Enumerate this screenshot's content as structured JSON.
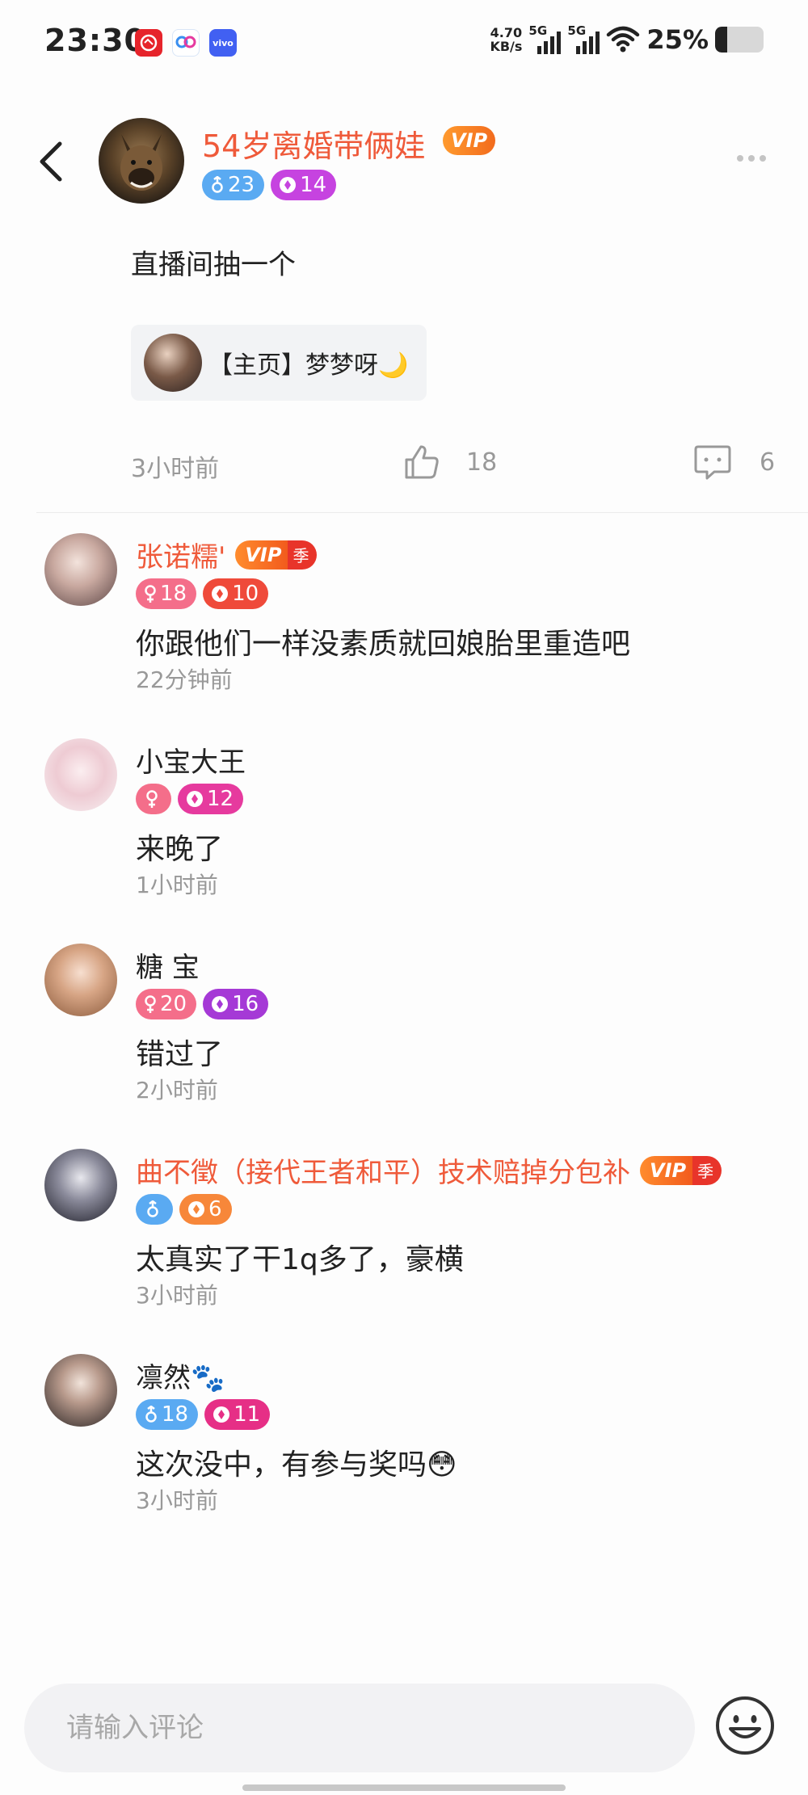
{
  "status_bar": {
    "time": "23:30",
    "net_speed_value": "4.70",
    "net_speed_unit": "KB/s",
    "sim1": "5G",
    "sim2": "5G",
    "battery": "25%",
    "battery_level": 0.25,
    "app_icons": [
      "pinduoduo-icon",
      "baidu-netdisk-icon",
      "vivo-icon"
    ],
    "app_label_3": "vivo"
  },
  "post": {
    "author": "54岁离婚带俩娃",
    "vip_label": "VIP",
    "badges": [
      {
        "type": "male",
        "value": "23"
      },
      {
        "type": "level",
        "value": "14"
      }
    ],
    "text": "直播间抽一个",
    "card_text": "【主页】梦梦呀🌙",
    "time": "3小时前",
    "likes": "18",
    "comments": "6"
  },
  "comments": [
    {
      "name": "张诺糯'",
      "vip": "VIP",
      "season": "季",
      "gender_value": "18",
      "level": "10",
      "text": "你跟他们一样没素质就回娘胎里重造吧",
      "time": "22分钟前"
    },
    {
      "name": "小宝大王",
      "gender_value": "",
      "level": "12",
      "text": "来晚了",
      "time": "1小时前"
    },
    {
      "name": "糖 宝",
      "gender_value": "20",
      "level": "16",
      "text": "错过了",
      "time": "2小时前"
    },
    {
      "name": "曲不徵（接代王者和平）技术赔掉分包补",
      "vip": "VIP",
      "season": "季",
      "gender_value": "",
      "level": "6",
      "text": "太真实了干1q多了，豪横",
      "time": "3小时前"
    },
    {
      "name": "凛然🐾",
      "gender_value": "18",
      "level": "11",
      "text": "这次没中，有参与奖吗😳",
      "time": "3小时前"
    }
  ],
  "input": {
    "placeholder": "请输入评论",
    "value": ""
  },
  "colors": {
    "vip_name": "#ef5a3a",
    "male_badge": "#5aaaf2",
    "female_badge": "#f46e8a",
    "meta_gray": "#999999"
  }
}
